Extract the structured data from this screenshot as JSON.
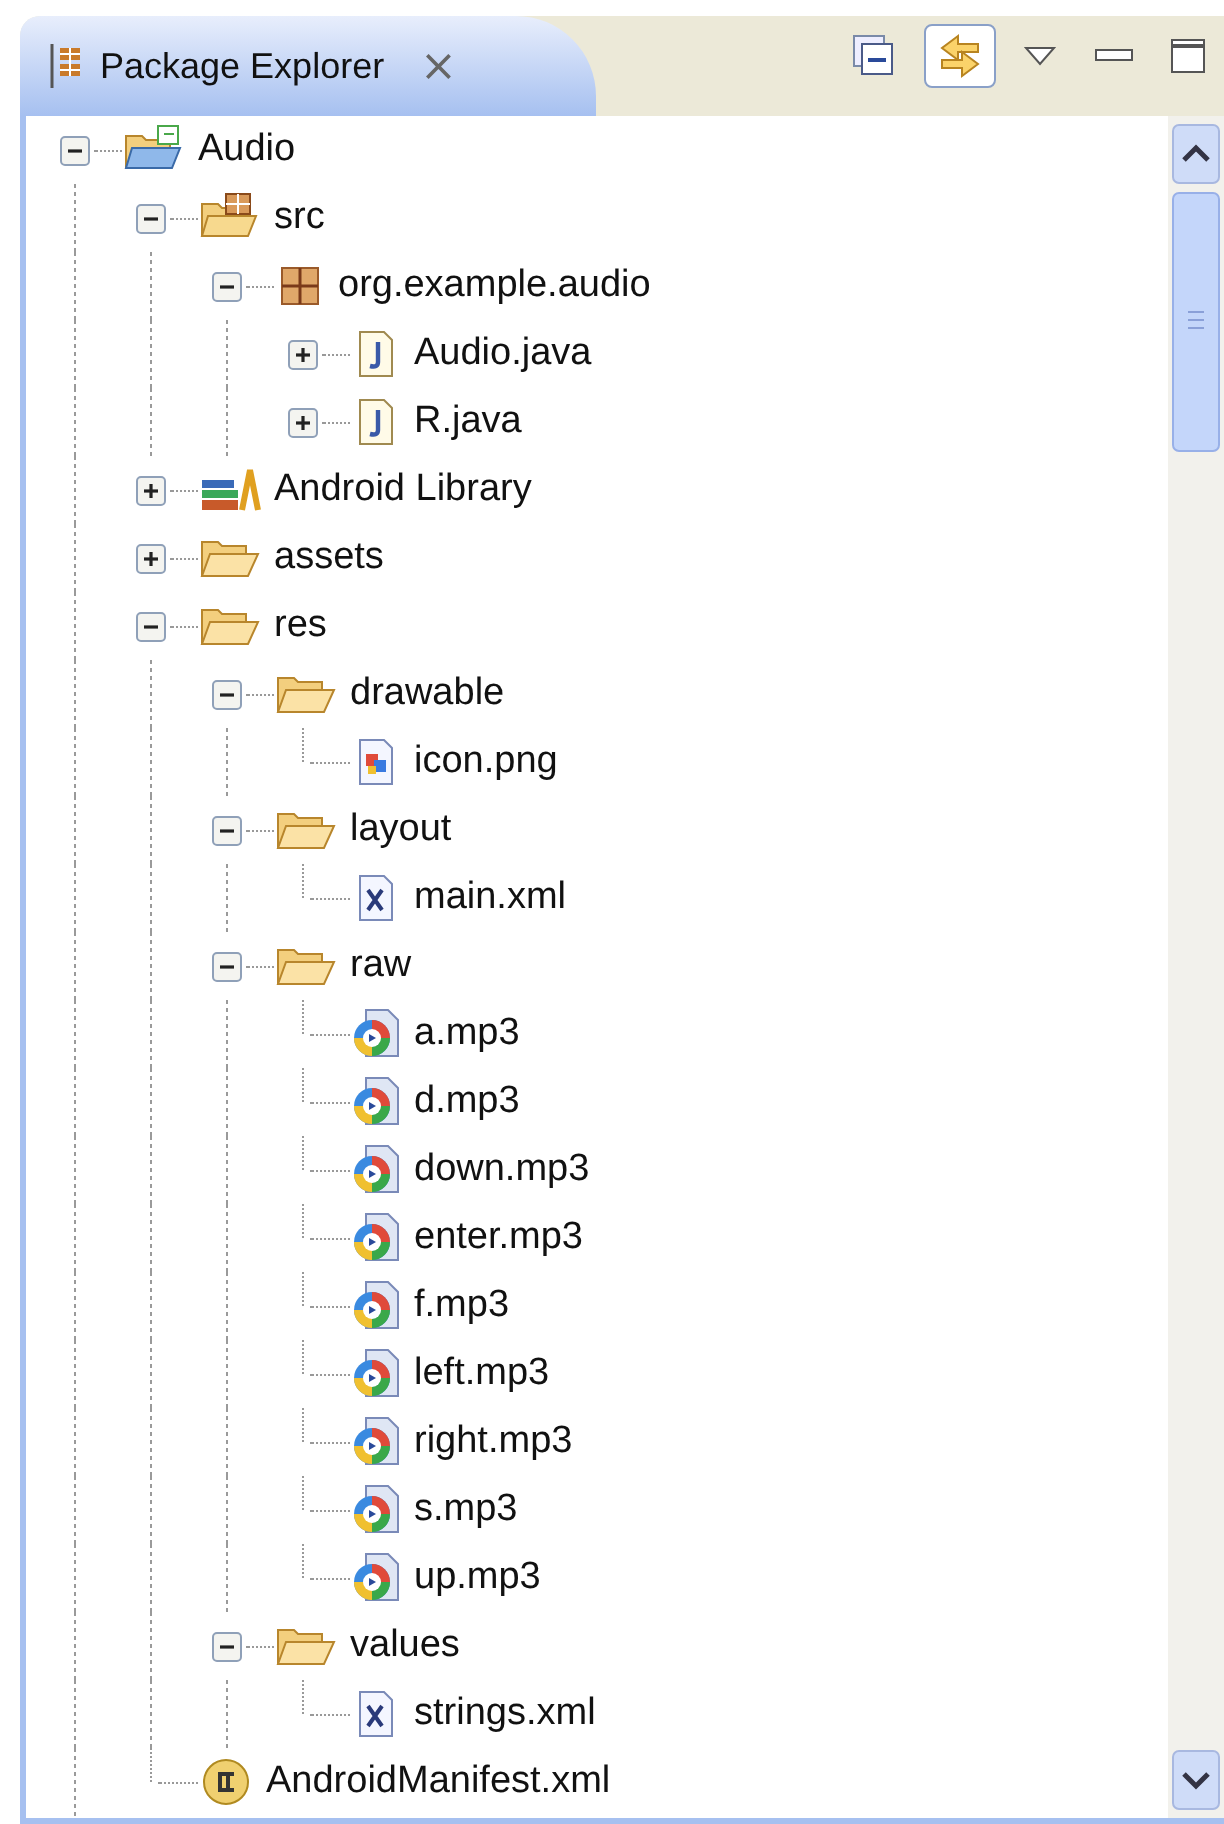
{
  "view": {
    "title": "Package Explorer",
    "close_glyph": "⨯"
  },
  "toolbar": [
    {
      "kind": "collapse",
      "pressed": false
    },
    {
      "kind": "link",
      "pressed": true
    },
    {
      "kind": "menu",
      "pressed": false
    },
    {
      "kind": "minimize",
      "pressed": false
    },
    {
      "kind": "maximize",
      "pressed": false
    }
  ],
  "tree": [
    {
      "label": "Audio",
      "kind": "project",
      "expanded": true,
      "children": [
        {
          "label": "src",
          "kind": "src",
          "expanded": true,
          "children": [
            {
              "label": "org.example.audio",
              "kind": "package",
              "expanded": true,
              "children": [
                {
                  "label": "Audio.java",
                  "kind": "java",
                  "expanded": false
                },
                {
                  "label": "R.java",
                  "kind": "java",
                  "expanded": false
                }
              ]
            }
          ]
        },
        {
          "label": "Android Library",
          "kind": "library",
          "expanded": false
        },
        {
          "label": "assets",
          "kind": "folder",
          "expanded": false
        },
        {
          "label": "res",
          "kind": "folder",
          "expanded": true,
          "children": [
            {
              "label": "drawable",
              "kind": "folder",
              "expanded": true,
              "children": [
                {
                  "label": "icon.png",
                  "kind": "image"
                }
              ]
            },
            {
              "label": "layout",
              "kind": "folder",
              "expanded": true,
              "children": [
                {
                  "label": "main.xml",
                  "kind": "xml"
                }
              ]
            },
            {
              "label": "raw",
              "kind": "folder",
              "expanded": true,
              "children": [
                {
                  "label": "a.mp3",
                  "kind": "audio"
                },
                {
                  "label": "d.mp3",
                  "kind": "audio"
                },
                {
                  "label": "down.mp3",
                  "kind": "audio"
                },
                {
                  "label": "enter.mp3",
                  "kind": "audio"
                },
                {
                  "label": "f.mp3",
                  "kind": "audio"
                },
                {
                  "label": "left.mp3",
                  "kind": "audio"
                },
                {
                  "label": "right.mp3",
                  "kind": "audio"
                },
                {
                  "label": "s.mp3",
                  "kind": "audio"
                },
                {
                  "label": "up.mp3",
                  "kind": "audio"
                }
              ]
            },
            {
              "label": "values",
              "kind": "folder",
              "expanded": true,
              "children": [
                {
                  "label": "strings.xml",
                  "kind": "xml"
                }
              ]
            }
          ]
        },
        {
          "label": "AndroidManifest.xml",
          "kind": "manifest"
        }
      ]
    }
  ]
}
